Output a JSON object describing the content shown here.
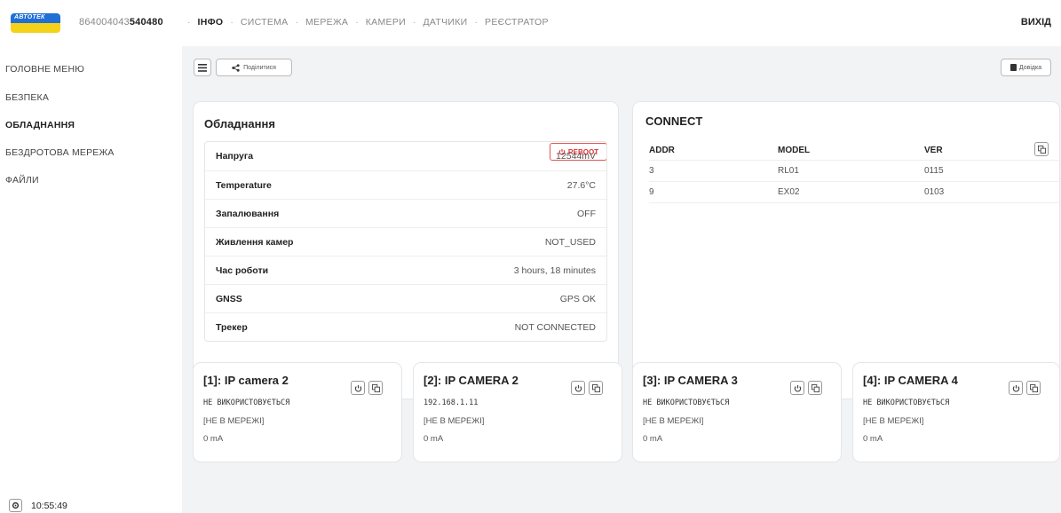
{
  "logo": {
    "text": "АВТОТЕК"
  },
  "header": {
    "device_id_prefix": "864004043",
    "device_id_suffix": "540480",
    "nav": [
      "ІНФО",
      "СИСТЕМА",
      "МЕРЕЖА",
      "КАМЕРИ",
      "ДАТЧИКИ",
      "РЕЄСТРАТОР"
    ],
    "exit_label": "ВИХІД"
  },
  "sidebar": {
    "items": [
      {
        "label": "ГОЛОВНЕ МЕНЮ",
        "active": false
      },
      {
        "label": "БЕЗПЕКА",
        "active": false
      },
      {
        "label": "ОБЛАДНАННЯ",
        "active": true
      },
      {
        "label": "БЕЗДРОТОВА МЕРЕЖА",
        "active": false
      },
      {
        "label": "ФАЙЛИ",
        "active": false
      }
    ],
    "clock": "10:55:49"
  },
  "toolbar": {
    "share_label": "Поділитися",
    "help_label": "Довідка"
  },
  "hardware": {
    "title": "Обладнання",
    "reboot_label": "REBOOT",
    "rows": [
      {
        "key": "Напруга",
        "value": "12544mV"
      },
      {
        "key": "Temperature",
        "value": "27.6°C"
      },
      {
        "key": "Запалювання",
        "value": "OFF"
      },
      {
        "key": "Живлення камер",
        "value": "NOT_USED"
      },
      {
        "key": "Час роботи",
        "value": "3 hours, 18 minutes"
      },
      {
        "key": "GNSS",
        "value": "GPS OK"
      },
      {
        "key": "Трекер",
        "value": "NOT CONNECTED"
      }
    ]
  },
  "connect": {
    "title": "CONNECT",
    "columns": [
      "ADDR",
      "MODEL",
      "VER"
    ],
    "rows": [
      [
        "3",
        "RL01",
        "0115"
      ],
      [
        "9",
        "EX02",
        "0103"
      ]
    ]
  },
  "cameras": [
    {
      "title": "[1]: IP camera 2",
      "line1": "НЕ ВИКОРИСТОВУЄТЬСЯ",
      "line2": "[НЕ В МЕРЕЖІ]",
      "line3": "0 mA"
    },
    {
      "title": "[2]: IP CAMERA 2",
      "line1": "192.168.1.11",
      "line2": "[НЕ В МЕРЕЖІ]",
      "line3": "0 mA"
    },
    {
      "title": "[3]: IP CAMERA 3",
      "line1": "НЕ ВИКОРИСТОВУЄТЬСЯ",
      "line2": "[НЕ В МЕРЕЖІ]",
      "line3": "0 mA"
    },
    {
      "title": "[4]: IP CAMERA 4",
      "line1": "НЕ ВИКОРИСТОВУЄТЬСЯ",
      "line2": "[НЕ В МЕРЕЖІ]",
      "line3": "0 mA"
    }
  ],
  "colors": {
    "accent_red": "#dd3333",
    "logo_blue": "#1f6fd6",
    "logo_yellow": "#f5d21a"
  }
}
